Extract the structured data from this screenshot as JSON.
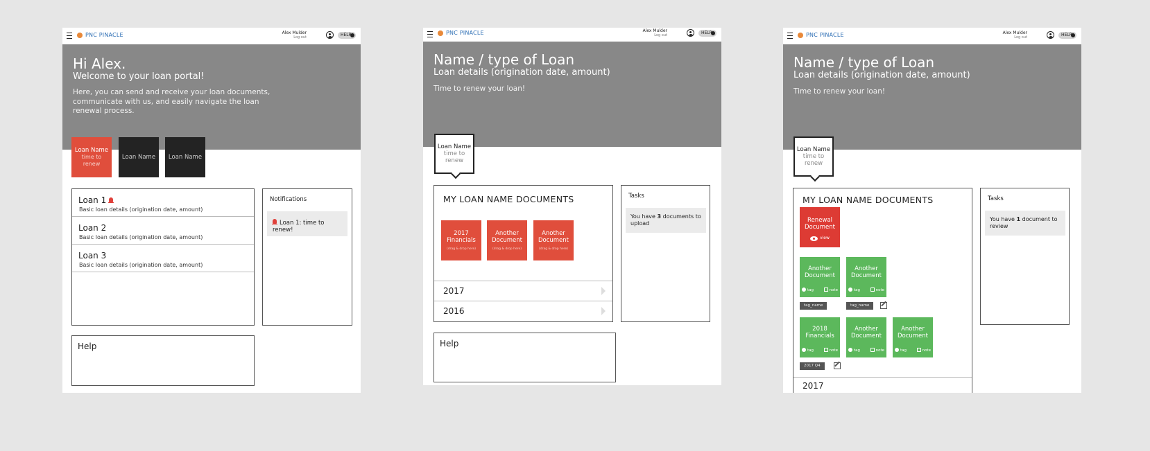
{
  "brand": "PNC PINACLE",
  "user": {
    "name": "Alex Mulder",
    "logout": "Log out"
  },
  "help_button": "HELP",
  "screen1": {
    "title": "Hi Alex.",
    "subtitle": "Welcome to your loan portal!",
    "intro": "Here, you can send and receive your loan documents, communicate with us, and easily navigate the loan renewal process.",
    "tiles": [
      {
        "name": "Loan Name",
        "line2": "time to",
        "line3": "renew"
      },
      {
        "name": "Loan Name"
      },
      {
        "name": "Loan Name"
      }
    ],
    "loans": [
      {
        "title": "Loan 1",
        "detail": "Basic loan details (origination date, amount)"
      },
      {
        "title": "Loan 2",
        "detail": "Basic loan details (origination date, amount)"
      },
      {
        "title": "Loan 3",
        "detail": "Basic loan details (origination date, amount)"
      }
    ],
    "notifications": {
      "title": "Notifications",
      "item": "Loan 1: time to renew!"
    },
    "help": "Help"
  },
  "screen2": {
    "title": "Name / type of Loan",
    "subtitle": "Loan details (origination date, amount)",
    "message": "Time to renew your loan!",
    "callout": {
      "name": "Loan Name",
      "line2": "time to",
      "line3": "renew"
    },
    "docs_title": "MY LOAN NAME DOCUMENTS",
    "docs": [
      {
        "line1": "2017",
        "line2": "Financials",
        "hint": "(drag & drop here)"
      },
      {
        "line1": "Another",
        "line2": "Document",
        "hint": "(drag & drop here)"
      },
      {
        "line1": "Another",
        "line2": "Document",
        "hint": "(drag & drop here)"
      }
    ],
    "years": [
      "2017",
      "2016"
    ],
    "tasks": {
      "title": "Tasks",
      "pre": "You have ",
      "count": "3",
      "post": " documents to upload"
    },
    "help": "Help"
  },
  "screen3": {
    "title": "Name / type of Loan",
    "subtitle": "Loan details (origination date, amount)",
    "message": "Time to renew your loan!",
    "callout": {
      "name": "Loan Name",
      "line2": "time to",
      "line3": "renew"
    },
    "docs_title": "MY LOAN NAME DOCUMENTS",
    "renewal": {
      "line1": "Renewal",
      "line2": "Document",
      "action": "view"
    },
    "row1": [
      {
        "line1": "Another",
        "line2": "Document"
      },
      {
        "line1": "Another",
        "line2": "Document"
      }
    ],
    "row1_tags": [
      "tag_name",
      "tag_name"
    ],
    "row2": [
      {
        "line1": "2018",
        "line2": "Financials"
      },
      {
        "line1": "Another",
        "line2": "Document"
      },
      {
        "line1": "Another",
        "line2": "Document"
      }
    ],
    "row2_tag": "2017 Q4",
    "actions": {
      "tag": "tag",
      "note": "note"
    },
    "year": "2017",
    "tasks": {
      "title": "Tasks",
      "pre": "You have ",
      "count": "1",
      "post": " document to review"
    }
  }
}
